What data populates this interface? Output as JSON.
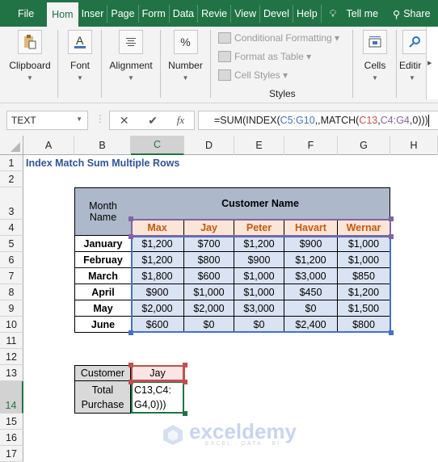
{
  "tabs": [
    {
      "label": "File",
      "active": false
    },
    {
      "label": "Hom",
      "active": true
    },
    {
      "label": "Inser",
      "active": false
    },
    {
      "label": "Page",
      "active": false
    },
    {
      "label": "Form",
      "active": false
    },
    {
      "label": "Data",
      "active": false
    },
    {
      "label": "Revie",
      "active": false
    },
    {
      "label": "View",
      "active": false
    },
    {
      "label": "Devel",
      "active": false
    },
    {
      "label": "Help",
      "active": false
    }
  ],
  "tell_me": "Tell me",
  "share": "Share",
  "ribbon": {
    "clipboard": "Clipboard",
    "font": "Font",
    "alignment": "Alignment",
    "number": "Number",
    "number_icon": "%",
    "conditional_formatting": "Conditional Formatting ▾",
    "format_as_table": "Format as Table ▾",
    "cell_styles": "Cell Styles ▾",
    "styles": "Styles",
    "cells": "Cells",
    "editing": "Editir"
  },
  "formula_bar": {
    "name_box": "TEXT",
    "formula_parts": [
      {
        "t": "=SUM(INDEX(",
        "c": ""
      },
      {
        "t": "C5:G10",
        "c": "f-blue"
      },
      {
        "t": ",,MATCH(",
        "c": ""
      },
      {
        "t": "C13",
        "c": "f-red"
      },
      {
        "t": ",",
        "c": ""
      },
      {
        "t": "C4:G4",
        "c": "f-purple"
      },
      {
        "t": ",0)))",
        "c": ""
      }
    ]
  },
  "columns": [
    "A",
    "B",
    "C",
    "D",
    "E",
    "F",
    "G",
    "H"
  ],
  "selected_column": "C",
  "rows": [
    "1",
    "2",
    "3",
    "4",
    "5",
    "6",
    "7",
    "8",
    "9",
    "10",
    "11",
    "12",
    "13",
    "14",
    "15",
    "16",
    "17"
  ],
  "selected_row": "14",
  "sheet": {
    "title": "Index Match Sum Multiple Rows",
    "month_header": "Month Name",
    "customer_header": "Customer Name",
    "customers": [
      "Max",
      "Jay",
      "Peter",
      "Havart",
      "Wernar"
    ],
    "table": [
      {
        "month": "January",
        "values": [
          "$1,200",
          "$700",
          "$1,200",
          "$900",
          "$1,000"
        ]
      },
      {
        "month": "Februay",
        "values": [
          "$1,200",
          "$800",
          "$900",
          "$1,200",
          "$1,000"
        ]
      },
      {
        "month": "March",
        "values": [
          "$1,800",
          "$600",
          "$1,000",
          "$3,000",
          "$850"
        ]
      },
      {
        "month": "April",
        "values": [
          "$900",
          "$1,000",
          "$1,000",
          "$450",
          "$1,200"
        ]
      },
      {
        "month": "May",
        "values": [
          "$2,000",
          "$2,000",
          "$3,000",
          "$0",
          "$1,500"
        ]
      },
      {
        "month": "June",
        "values": [
          "$600",
          "$0",
          "$0",
          "$2,400",
          "$800"
        ]
      }
    ],
    "lookup_label": "Customer",
    "lookup_value": "Jay",
    "total_label_1": "Total",
    "total_label_2": "Purchase",
    "edit_line_1": "C13,C4:",
    "edit_line_2": "G4,0)))"
  },
  "watermark": {
    "name": "exceldemy",
    "tagline": "EXCEL · DATA · BI"
  }
}
